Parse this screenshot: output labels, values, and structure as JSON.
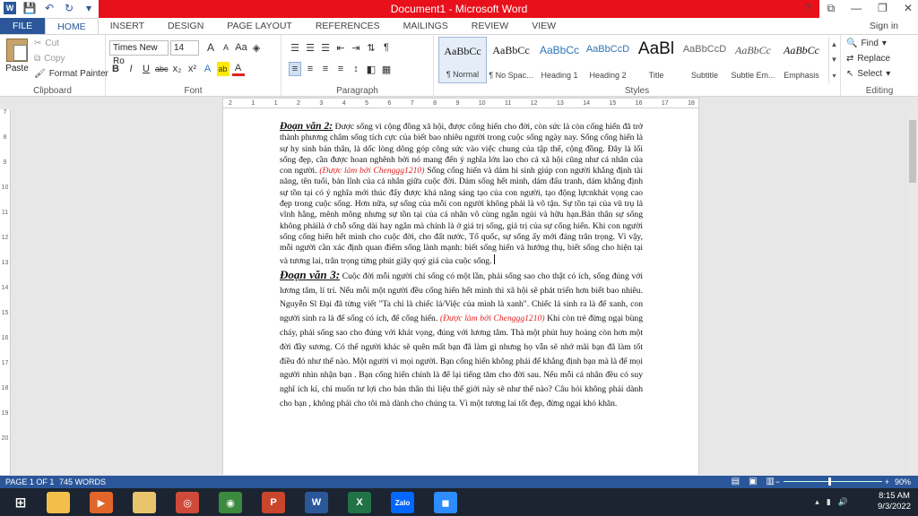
{
  "window": {
    "title": "Document1 - Microsoft Word",
    "buttons": [
      "?",
      "⧉",
      "—",
      "❐",
      "✕"
    ]
  },
  "tabs": [
    "FILE",
    "HOME",
    "INSERT",
    "DESIGN",
    "PAGE LAYOUT",
    "REFERENCES",
    "MAILINGS",
    "REVIEW",
    "VIEW"
  ],
  "signin": "Sign in",
  "clipboard": {
    "paste": "Paste",
    "cut": "Cut",
    "copy": "Copy",
    "format_painter": "Format Painter",
    "label": "Clipboard"
  },
  "font": {
    "name": "Times New Ro",
    "size": "14",
    "label": "Font",
    "row1": [
      "A",
      "A",
      "Aa",
      "◈"
    ],
    "row2": [
      "B",
      "I",
      "U",
      "abc",
      "x₂",
      "x²",
      "A",
      "ab",
      "A"
    ]
  },
  "paragraph": {
    "label": "Paragraph",
    "row1": [
      "☰",
      "☰",
      "☰",
      "⇤",
      "⇥",
      "⇅",
      "¶"
    ],
    "row2": [
      "≡",
      "≡",
      "≡",
      "≡",
      "↕",
      "◧",
      "▦"
    ]
  },
  "styles": {
    "label": "Styles",
    "items": [
      {
        "sample": "AaBbCc",
        "name": "¶ Normal"
      },
      {
        "sample": "AaBbCc",
        "name": "¶ No Spac..."
      },
      {
        "sample": "AaBbCc",
        "name": "Heading 1"
      },
      {
        "sample": "AaBbCcD",
        "name": "Heading 2"
      },
      {
        "sample": "AaBl",
        "name": "Title"
      },
      {
        "sample": "AaBbCcD",
        "name": "Subtitle"
      },
      {
        "sample": "AaBbCc",
        "name": "Subtle Em..."
      },
      {
        "sample": "AaBbCc",
        "name": "Emphasis"
      }
    ]
  },
  "editing": {
    "find": "Find",
    "replace": "Replace",
    "select": "Select",
    "label": "Editing"
  },
  "ruler": [
    "2",
    "1",
    "1",
    "2",
    "3",
    "4",
    "5",
    "6",
    "7",
    "8",
    "9",
    "10",
    "11",
    "12",
    "13",
    "14",
    "15",
    "16",
    "17",
    "18"
  ],
  "vruler": [
    "7",
    "8",
    "9",
    "10",
    "11",
    "12",
    "13",
    "14",
    "15",
    "16",
    "17",
    "18",
    "19",
    "20"
  ],
  "doc": {
    "p2_head": "Đoạn văn 2:",
    "p2_a": " Được sống vì cộng đồng xã hội, được cống hiến cho đời, còn sức là còn cống hiến đã trở thành phương châm sống tích cực của biết bao nhiêu người trong cuộc sống ngày nay.  Sống cống hiến là sự hy sinh bản thân, là dốc lòng dông góp công sức vào việc chung của tập thể, cộng đồng. Đây là lối sống đẹp, cần được hoan nghênh bởi nó mang đến ý nghĩa lớn lao cho cả xã hội cũng như cá nhân của con người. ",
    "p2_red": "(Được làm bởi Chenggg1210)",
    "p2_b": "  Sống cống hiến và dám hi sinh giúp con người khẳng định tài năng, tên tuổi, bản lĩnh của cá nhân giữa cuộc đời. Dám sống hết mình, dám đấu tranh, dám khẳng định sự tồn tại có ý nghĩa mới thúc đẩy được khả năng sáng tạo của con người, tạo động lựcnkhát vọng cao đẹp trong cuộc sống. Hơn nữa, sự sống của mỗi con người không phải là vô tận. Sự tồn tại của vũ trụ là vĩnh hằng, mênh mông nhưng sự tồn tại của cá nhân vô cùng ngắn ngủi và hữu hạn.Bản thân sự sống không phảilà ở chỗ sống dài hay ngắn mà chính là ở giá trị sống, giá trị của sự cống hiến. Khi con người sống cống hiến hết mình cho cuộc đời, cho đất nước, Tổ quốc, sự sống ấy mới đáng trân trọng. Vì vậy, mỗi người cần xác định quan điểm sống lành mạnh: biết sống hiến và hướng thụ, biết sống cho hiện tại và tương lai, trân trọng từng phút giây quý giá của cuộc sống. ",
    "p3_head": "Đoạn văn 3:",
    "p3_a": " Cuộc đời mỗi người chỉ sống có một lần, phải sống sao cho thật có ích, sống đúng với lương tâm, lí trí. Nếu mỗi một người đều cống hiến hết mình thì xã hội sẽ phát triển hơn biết bao nhiêu. Nguyễn Sĩ Đại đã từng viết \"Ta chỉ là chiếc lá/Việc của mình là xanh\". Chiếc lá sinh ra là để xanh, con người sinh ra là để sống có ích, để cống hiến. ",
    "p3_red": "(Được làm bởi Chenggg1210)",
    "p3_b": "  Khi còn trẻ đừng ngại bùng cháy, phải sống sao cho đúng với khát vọng, đúng với lương tâm. Thà một phút huy hoàng còn hơn một đời đầy sương. Có thể người khác sẽ quên mất bạn đã làm gì nhưng họ vẫn sẽ nhớ mãi bạn đã làm tốt điều đó như thế nào. Một người vì mọi người. Bạn cống hiến không phải để khẳng định bạn mà là để mọi người nhìn nhận bạn . Bạn cống hiến chính là để lại tiếng tăm cho đời sau. Nếu mỗi cá nhân đều có suy nghĩ ích kỉ, chỉ muốn tư lợi cho bản thân thì liệu thế giới này sẽ như thế nào? Câu hỏi không phải dành cho bạn , không phải cho tôi mà dành cho chúng ta. Vì một tương lai tốt đẹp, đừng ngại khó khăn."
  },
  "status": {
    "page": "PAGE 1 OF 1",
    "words": "745 WORDS",
    "zoom": "90%",
    "minus": "−",
    "plus": "+"
  },
  "taskbar": {
    "time": "8:15 AM",
    "date": "9/3/2022",
    "apps": [
      {
        "name": "file-explorer",
        "label": "",
        "color": "#f2c04a"
      },
      {
        "name": "media-player",
        "label": "▶",
        "color": "#e2662a"
      },
      {
        "name": "folder",
        "label": "",
        "color": "#e8c46a"
      },
      {
        "name": "manager",
        "label": "◎",
        "color": "#d04a3a"
      },
      {
        "name": "chrome",
        "label": "◉",
        "color": "#3b8a3e"
      },
      {
        "name": "powerpoint",
        "label": "P",
        "color": "#c9462c"
      },
      {
        "name": "word",
        "label": "W",
        "color": "#2b579a"
      },
      {
        "name": "excel",
        "label": "X",
        "color": "#217346"
      },
      {
        "name": "zalo",
        "label": "Zalo",
        "color": "#0068ff"
      },
      {
        "name": "zoom",
        "label": "◼",
        "color": "#2d8cff"
      }
    ]
  },
  "colors": {
    "word_blue": "#2b579a",
    "title_red": "#e8101b",
    "credit_red": "#e02020"
  }
}
